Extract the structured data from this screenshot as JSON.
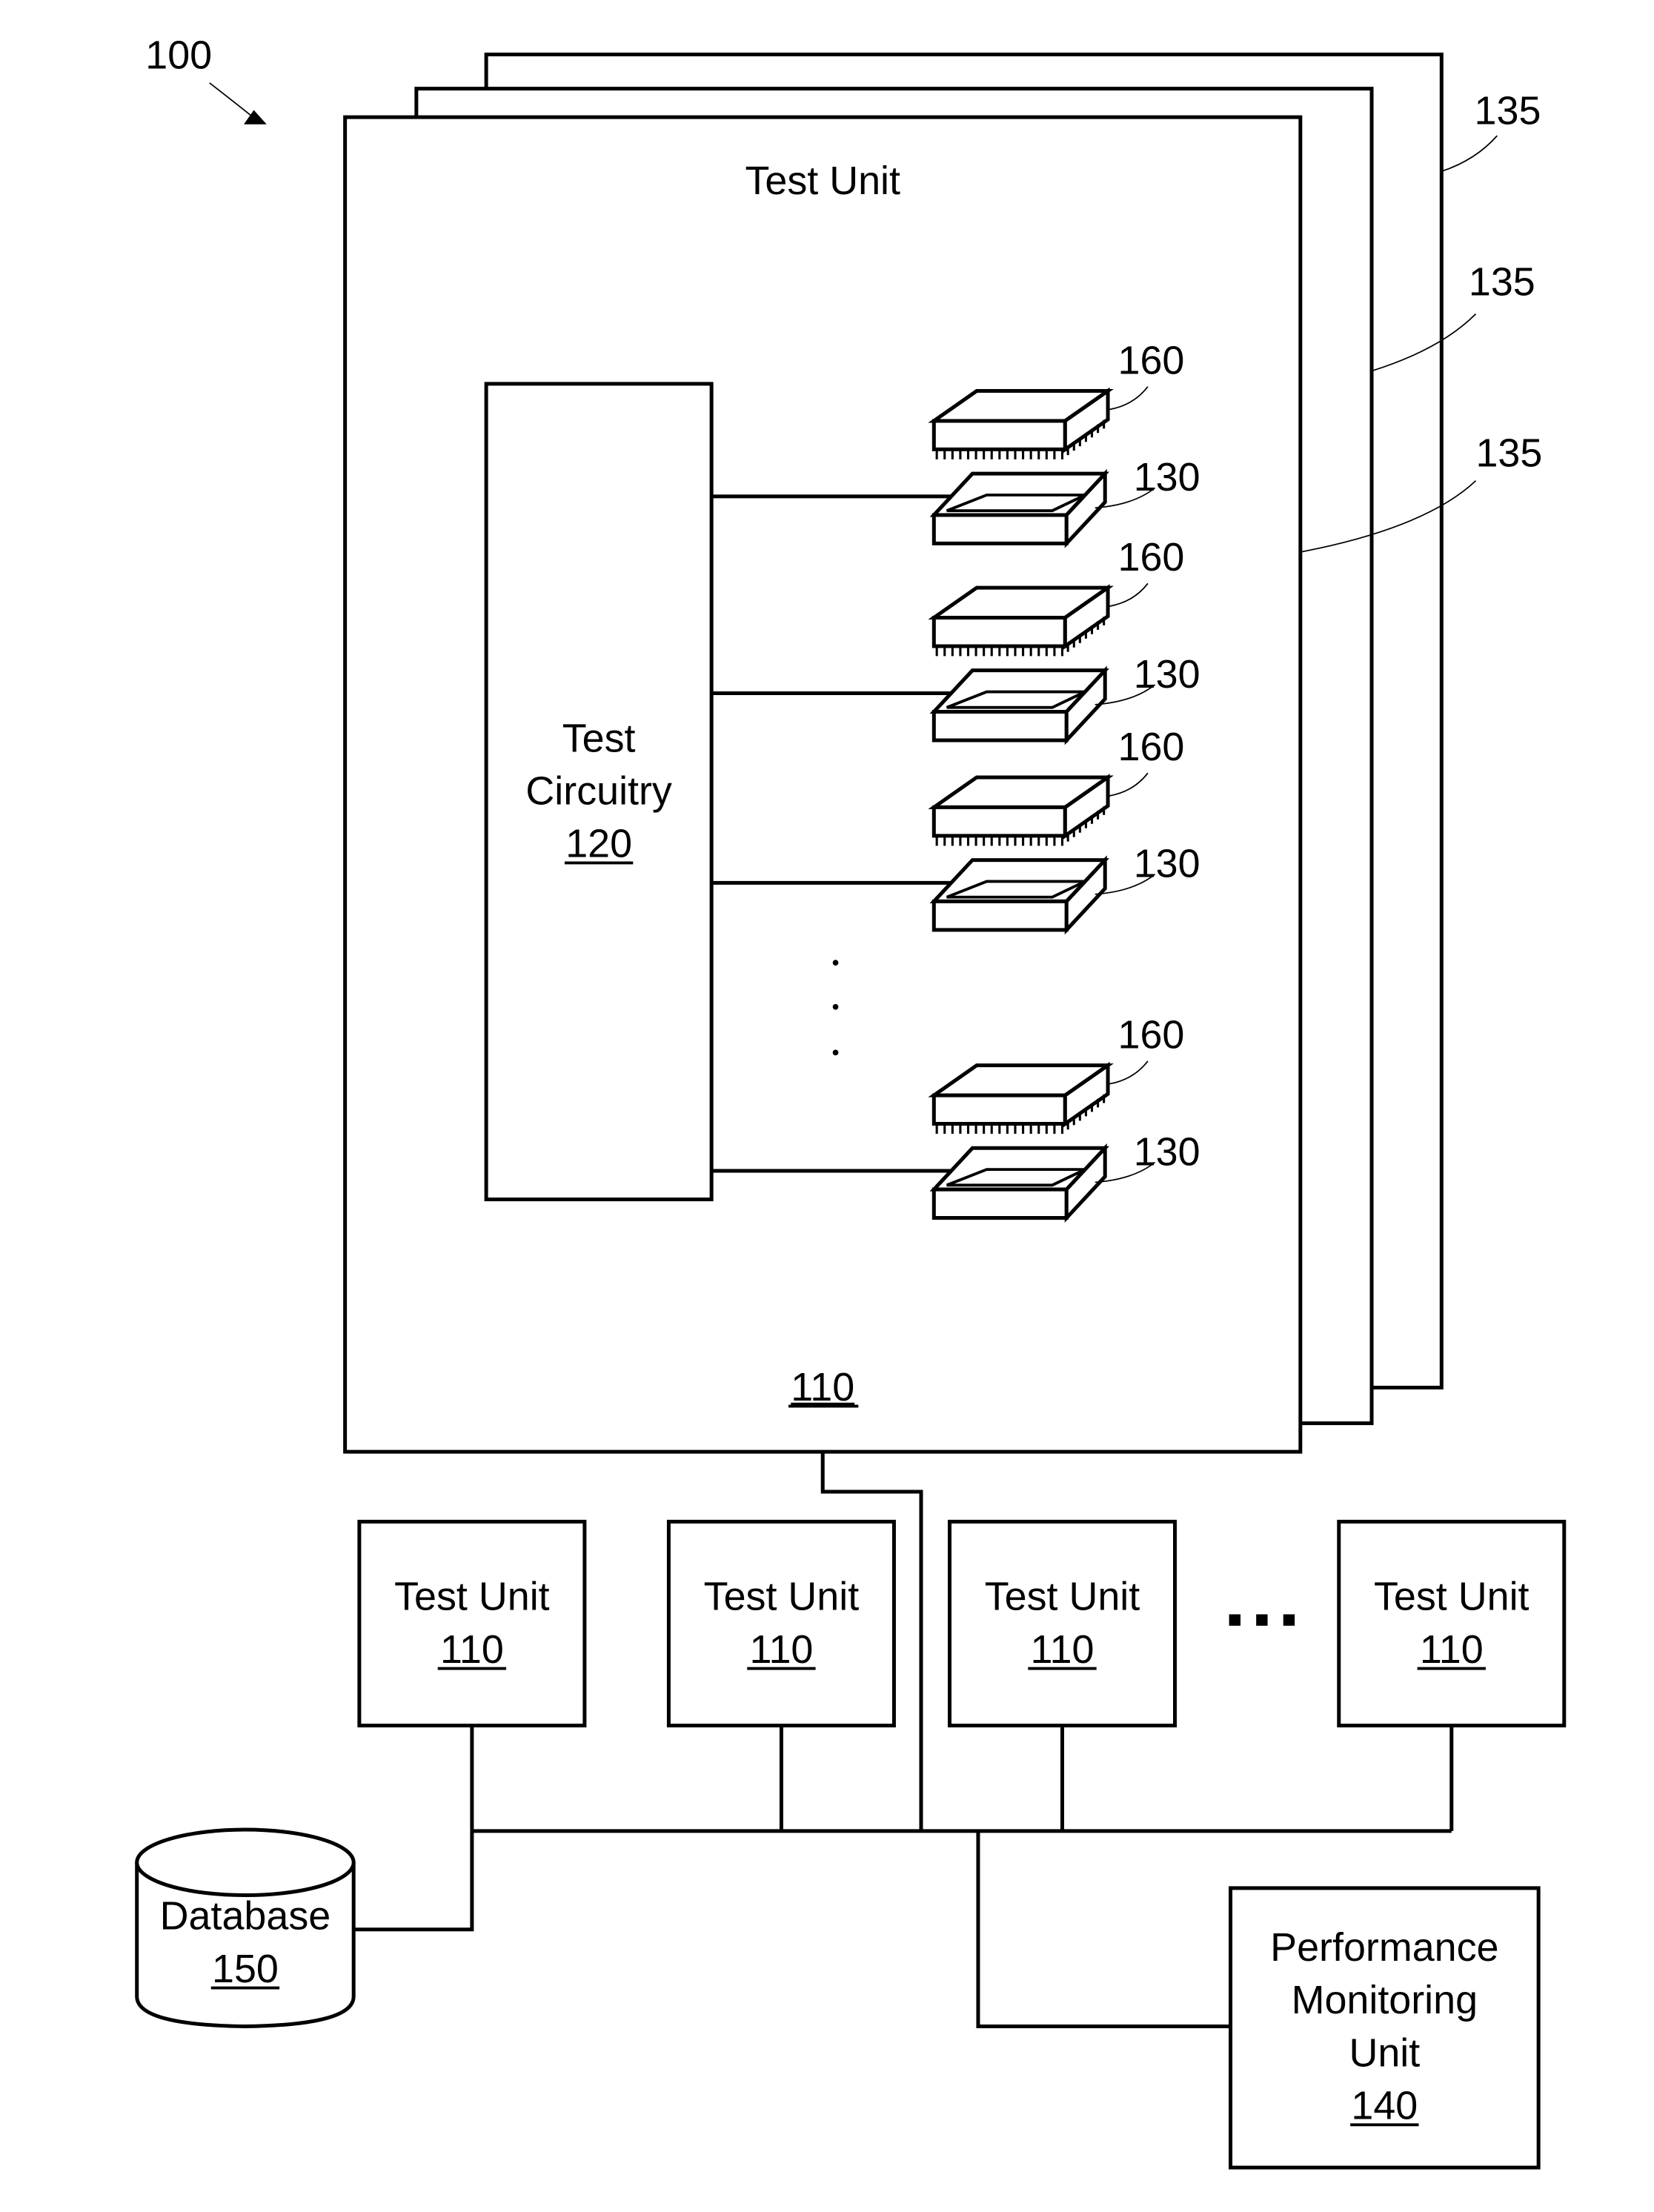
{
  "figure": {
    "reference": "100",
    "test_unit_stack": {
      "title": "Test Unit",
      "ref": "110",
      "layer_refs": [
        "135",
        "135",
        "135"
      ],
      "test_circuitry": {
        "label_line1": "Test",
        "label_line2": "Circuitry",
        "ref": "120"
      },
      "sockets": [
        {
          "device_ref": "160",
          "socket_ref": "130"
        },
        {
          "device_ref": "160",
          "socket_ref": "130"
        },
        {
          "device_ref": "160",
          "socket_ref": "130"
        },
        {
          "device_ref": "160",
          "socket_ref": "130"
        }
      ],
      "ellipsis": "· · ·"
    },
    "test_units": [
      {
        "label": "Test Unit",
        "ref": "110"
      },
      {
        "label": "Test Unit",
        "ref": "110"
      },
      {
        "label": "Test Unit",
        "ref": "110"
      },
      {
        "label": "Test Unit",
        "ref": "110"
      }
    ],
    "units_ellipsis": "···",
    "database": {
      "label": "Database",
      "ref": "150"
    },
    "performance_monitoring_unit": {
      "line1": "Performance",
      "line2": "Monitoring",
      "line3": "Unit",
      "ref": "140"
    }
  }
}
